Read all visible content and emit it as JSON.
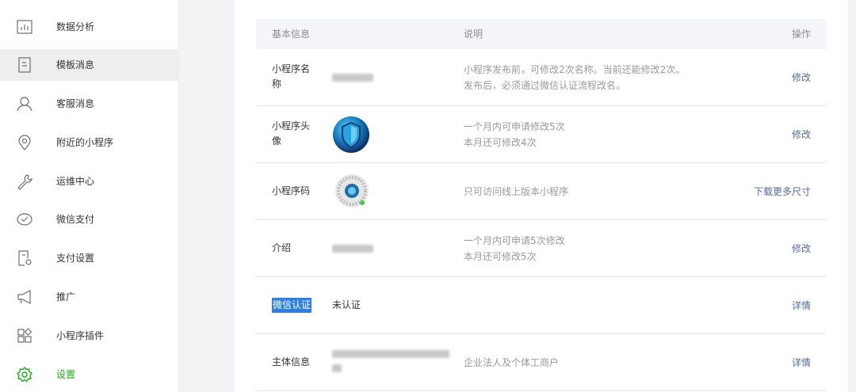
{
  "sidebar": {
    "items": [
      {
        "label": "数据分析",
        "icon": "bar-chart-icon"
      },
      {
        "label": "模板消息",
        "icon": "document-icon"
      },
      {
        "label": "客服消息",
        "icon": "user-icon"
      },
      {
        "label": "附近的小程序",
        "icon": "location-icon"
      },
      {
        "label": "运维中心",
        "icon": "wrench-icon"
      },
      {
        "label": "微信支付",
        "icon": "wechat-pay-icon"
      },
      {
        "label": "支付设置",
        "icon": "payment-settings-icon"
      },
      {
        "label": "推广",
        "icon": "megaphone-icon"
      },
      {
        "label": "小程序插件",
        "icon": "plugin-icon"
      },
      {
        "label": "设置",
        "icon": "gear-icon"
      }
    ],
    "active_index": 1,
    "selected_index": 9,
    "accent_color": "#1aad19"
  },
  "table": {
    "headers": {
      "basic": "基本信息",
      "desc": "说明",
      "op": "操作"
    },
    "rows": [
      {
        "label": "小程序名称",
        "desc1": "小程序发布前，可修改2次名称。当前还能修改2次。",
        "desc2": "发布后，必须通过微信认证流程改名。",
        "op": "修改"
      },
      {
        "label": "小程序头像",
        "desc1": "一个月内可申请修改5次",
        "desc2": "本月还可修改4次",
        "op": "修改"
      },
      {
        "label": "小程序码",
        "desc1": "只可访问线上版本小程序",
        "op": "下载更多尺寸"
      },
      {
        "label": "介绍",
        "desc1": "一个月内可申请5次修改",
        "desc2": "本月还可修改5次",
        "op": "修改"
      },
      {
        "label": "微信认证",
        "value": "未认证",
        "op": "详情"
      },
      {
        "label": "主体信息",
        "desc1": "企业法人及个体工商户",
        "op": "详情"
      }
    ]
  },
  "colors": {
    "link": "#576b95",
    "highlight": "#2f7fe0"
  }
}
